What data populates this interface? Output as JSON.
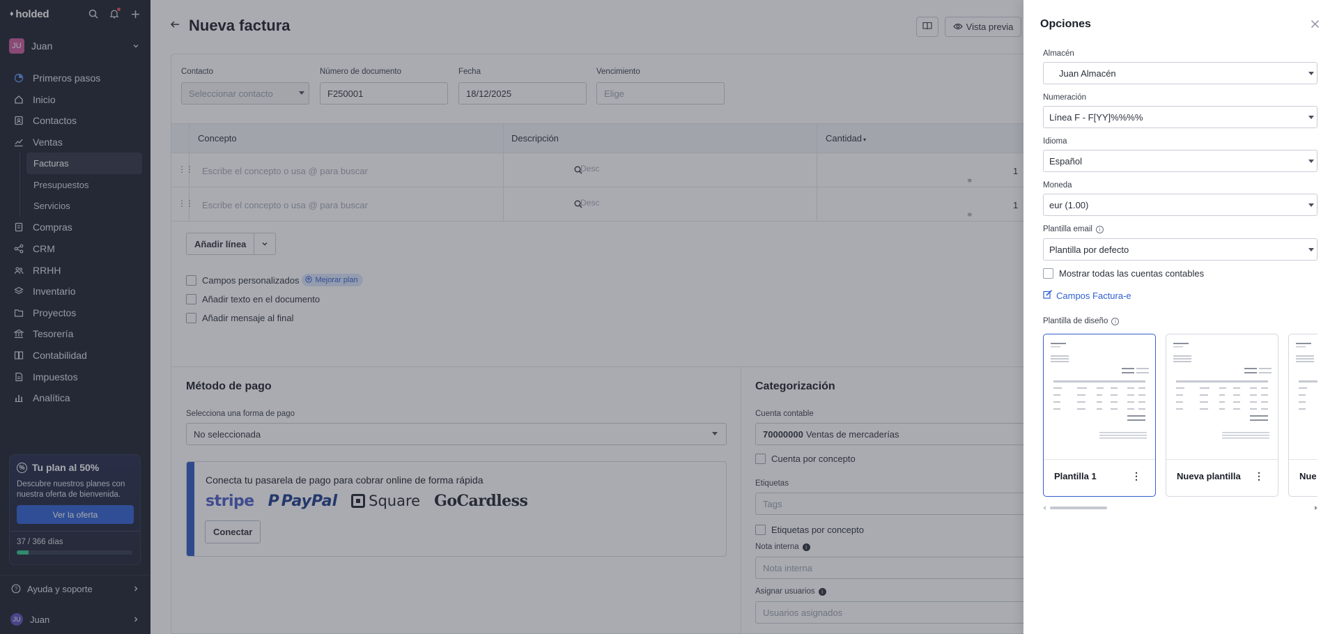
{
  "app": {
    "brand": "holded"
  },
  "sidebar": {
    "user": {
      "initials": "JU",
      "name": "Juan"
    },
    "items": [
      {
        "label": "Primeros pasos",
        "icon": "progress-circle-icon"
      },
      {
        "label": "Inicio",
        "icon": "home-icon"
      },
      {
        "label": "Contactos",
        "icon": "contacts-icon"
      },
      {
        "label": "Ventas",
        "icon": "chart-line-icon"
      },
      {
        "label": "Compras",
        "icon": "receipt-icon"
      },
      {
        "label": "CRM",
        "icon": "share-nodes-icon"
      },
      {
        "label": "RRHH",
        "icon": "people-icon"
      },
      {
        "label": "Inventario",
        "icon": "layers-icon"
      },
      {
        "label": "Proyectos",
        "icon": "folder-icon"
      },
      {
        "label": "Tesorería",
        "icon": "bank-icon"
      },
      {
        "label": "Contabilidad",
        "icon": "ledger-icon"
      },
      {
        "label": "Impuestos",
        "icon": "document-icon"
      },
      {
        "label": "Analítica",
        "icon": "bar-chart-icon"
      }
    ],
    "ventas_sub": [
      {
        "label": "Facturas",
        "active": true
      },
      {
        "label": "Presupuestos",
        "active": false
      },
      {
        "label": "Servicios",
        "active": false
      }
    ],
    "promo": {
      "title": "Tu plan al 50%",
      "description": "Descubre nuestros planes con nuestra oferta de bienvenida.",
      "button": "Ver la oferta",
      "days": "37 / 366 días",
      "progress": 0.101
    },
    "help": "Ayuda y soporte",
    "footer_user": {
      "initials": "JU",
      "name": "Juan"
    }
  },
  "main": {
    "title": "Nueva factura",
    "preview_button": "Vista previa",
    "fields": {
      "contacto": {
        "label": "Contacto",
        "placeholder": "Seleccionar contacto"
      },
      "numero": {
        "label": "Número de documento",
        "value": "F250001"
      },
      "fecha": {
        "label": "Fecha",
        "value": "18/12/2025"
      },
      "vencimiento": {
        "label": "Vencimiento",
        "placeholder": "Elige"
      }
    },
    "table": {
      "headers": {
        "concepto": "Concepto",
        "descripcion": "Descripción",
        "cantidad": "Cantidad"
      },
      "rows": [
        {
          "concept_placeholder": "Escribe el concepto o usa @ para buscar",
          "desc_placeholder": "Desc",
          "qty": "1"
        },
        {
          "concept_placeholder": "Escribe el concepto o usa @ para buscar",
          "desc_placeholder": "Desc",
          "qty": "1"
        }
      ]
    },
    "add_line": "Añadir línea",
    "checks": {
      "campos": "Campos personalizados",
      "mejorar": "Mejorar plan",
      "texto": "Añadir texto en el documento",
      "mensaje": "Añadir mensaje al final"
    },
    "payment": {
      "title": "Método de pago",
      "label": "Selecciona una forma de pago",
      "value": "No seleccionada",
      "gateway_title": "Conecta tu pasarela de pago para cobrar online de forma rápida",
      "providers": [
        "stripe",
        "PayPal",
        "Square",
        "GoCardless"
      ],
      "connect": "Conectar"
    },
    "categorization": {
      "title": "Categorización",
      "cuenta_label": "Cuenta contable",
      "cuenta_code": "70000000",
      "cuenta_name": "Ventas de mercaderías",
      "cuenta_por_concepto": "Cuenta por concepto",
      "etiquetas_label": "Etiquetas",
      "etiquetas_placeholder": "Tags",
      "etiquetas_por_concepto": "Etiquetas por concepto",
      "nota_label": "Nota interna",
      "nota_placeholder": "Nota interna",
      "asignar_label": "Asignar usuarios",
      "asignar_placeholder": "Usuarios asignados"
    }
  },
  "panel": {
    "title": "Opciones",
    "almacen": {
      "label": "Almacén",
      "value": "Juan Almacén"
    },
    "numeracion": {
      "label": "Numeración",
      "value": "Línea F - F[YY]%%%%"
    },
    "idioma": {
      "label": "Idioma",
      "value": "Español"
    },
    "moneda": {
      "label": "Moneda",
      "value": "eur (1.00)"
    },
    "plantilla_email": {
      "label": "Plantilla email",
      "value": "Plantilla por defecto"
    },
    "mostrar_cuentas": "Mostrar todas las cuentas contables",
    "campos_facturae": "Campos Factura-e",
    "plantilla_diseno": "Plantilla de diseño",
    "templates": [
      {
        "name": "Plantilla 1",
        "selected": true
      },
      {
        "name": "Nueva plantilla",
        "selected": false
      },
      {
        "name": "Nue",
        "selected": false
      }
    ]
  }
}
